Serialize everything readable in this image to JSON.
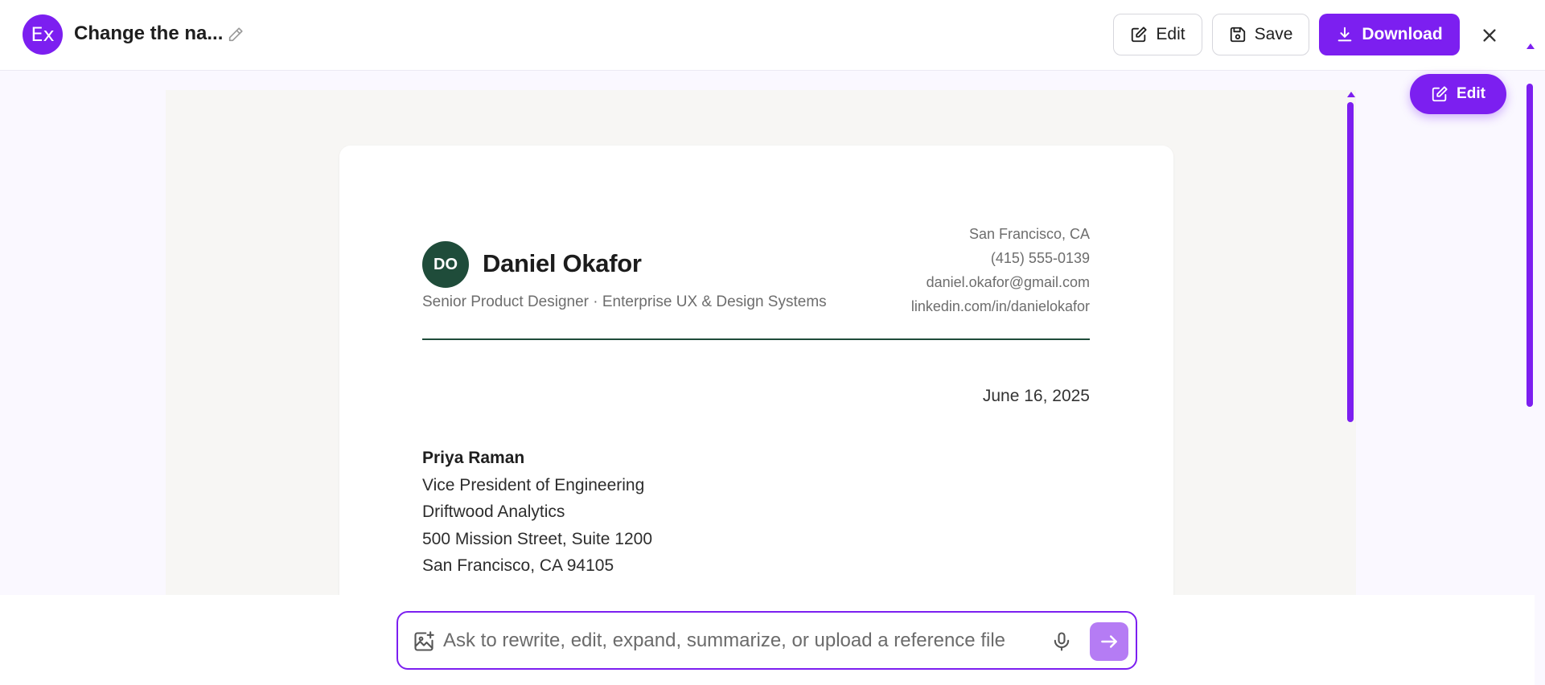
{
  "header": {
    "app_badge": "Ex",
    "title": "Change the na...",
    "edit_label": "Edit",
    "save_label": "Save",
    "download_label": "Download"
  },
  "float_edit_label": "Edit",
  "letter": {
    "monogram": "DO",
    "name": "Daniel Okafor",
    "subtitle": "Senior Product Designer · Enterprise UX & Design Systems",
    "contact": {
      "location": "San Francisco, CA",
      "phone": "(415) 555-0139",
      "email": "daniel.okafor@gmail.com",
      "linkedin": "linkedin.com/in/danielokafor"
    },
    "date": "June 16, 2025",
    "recipient": {
      "name": "Priya Raman",
      "title": "Vice President of Engineering",
      "company": "Driftwood Analytics",
      "address1": "500 Mission Street, Suite 1200",
      "address2": "San Francisco, CA 94105"
    }
  },
  "prompt": {
    "placeholder": "Ask to rewrite, edit, expand, summarize, or upload a reference file"
  },
  "icons": {
    "title_edit": "pencil-icon",
    "edit": "edit-square-icon",
    "save": "floppy-disk-icon",
    "download": "download-icon",
    "close": "close-icon",
    "image_upload": "image-plus-icon",
    "mic": "microphone-icon",
    "send": "arrow-right-icon"
  },
  "colors": {
    "accent": "#7c1ff0",
    "accent_light": "#b57cf4",
    "monogram_bg": "#1f4c3a"
  }
}
